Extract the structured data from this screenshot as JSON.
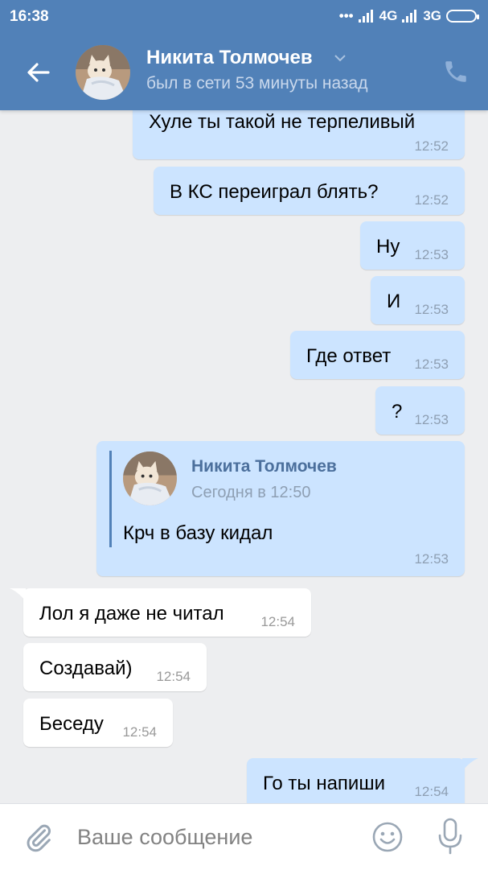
{
  "status": {
    "time": "16:38",
    "dots": "•••",
    "net1": "4G",
    "net2": "3G"
  },
  "header": {
    "name": "Никита Толмочев",
    "last_seen": "был в сети 53 минуты назад",
    "accent": "#5181b8"
  },
  "messages": [
    {
      "text": "Хуле ты такой не терпеливый",
      "time": "12:52",
      "dir": "out"
    },
    {
      "text": "В КС переиграл блять?",
      "time": "12:52",
      "dir": "out"
    },
    {
      "text": "Ну",
      "time": "12:53",
      "dir": "out"
    },
    {
      "text": "И",
      "time": "12:53",
      "dir": "out"
    },
    {
      "text": "Где ответ",
      "time": "12:53",
      "dir": "out"
    },
    {
      "text": "?",
      "time": "12:53",
      "dir": "out"
    },
    {
      "reply_name": "Никита Толмочев",
      "reply_date": "Сегодня в 12:50",
      "text": "Крч в базу кидал",
      "time": "12:53",
      "dir": "out"
    },
    {
      "text": "Лол я даже не читал",
      "time": "12:54",
      "dir": "in"
    },
    {
      "text": "Создавай)",
      "time": "12:54",
      "dir": "in"
    },
    {
      "text": "Беседу",
      "time": "12:54",
      "dir": "in"
    },
    {
      "text": "Го ты напиши",
      "time": "12:54",
      "dir": "out"
    }
  ],
  "input": {
    "placeholder": "Ваше сообщение"
  },
  "icons": {
    "back": "arrow-left-icon",
    "phone": "phone-icon",
    "attach": "paperclip-icon",
    "emoji": "smiley-icon",
    "mic": "microphone-icon"
  }
}
